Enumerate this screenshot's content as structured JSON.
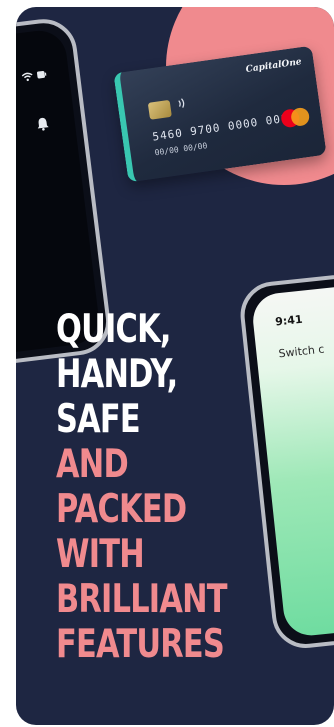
{
  "colors": {
    "background": "#1e2642",
    "accent_pink": "#f08a8e",
    "text_white": "#ffffff"
  },
  "card": {
    "brand": "CapitalOne",
    "number": "5460 9700 0000 0000",
    "expiry": "00/00 00/00",
    "network_icon": "mastercard-logo"
  },
  "left_phone": {
    "icons": [
      "wifi-icon",
      "battery-icon",
      "bell-icon"
    ]
  },
  "right_phone": {
    "time": "9:41",
    "text": "Switch c"
  },
  "headline": {
    "lines_white": [
      "QUICK,",
      "HANDY,",
      "SAFE"
    ],
    "lines_pink": [
      "AND",
      "PACKED",
      "WITH",
      "BRILLIANT",
      "FEATURES"
    ]
  }
}
